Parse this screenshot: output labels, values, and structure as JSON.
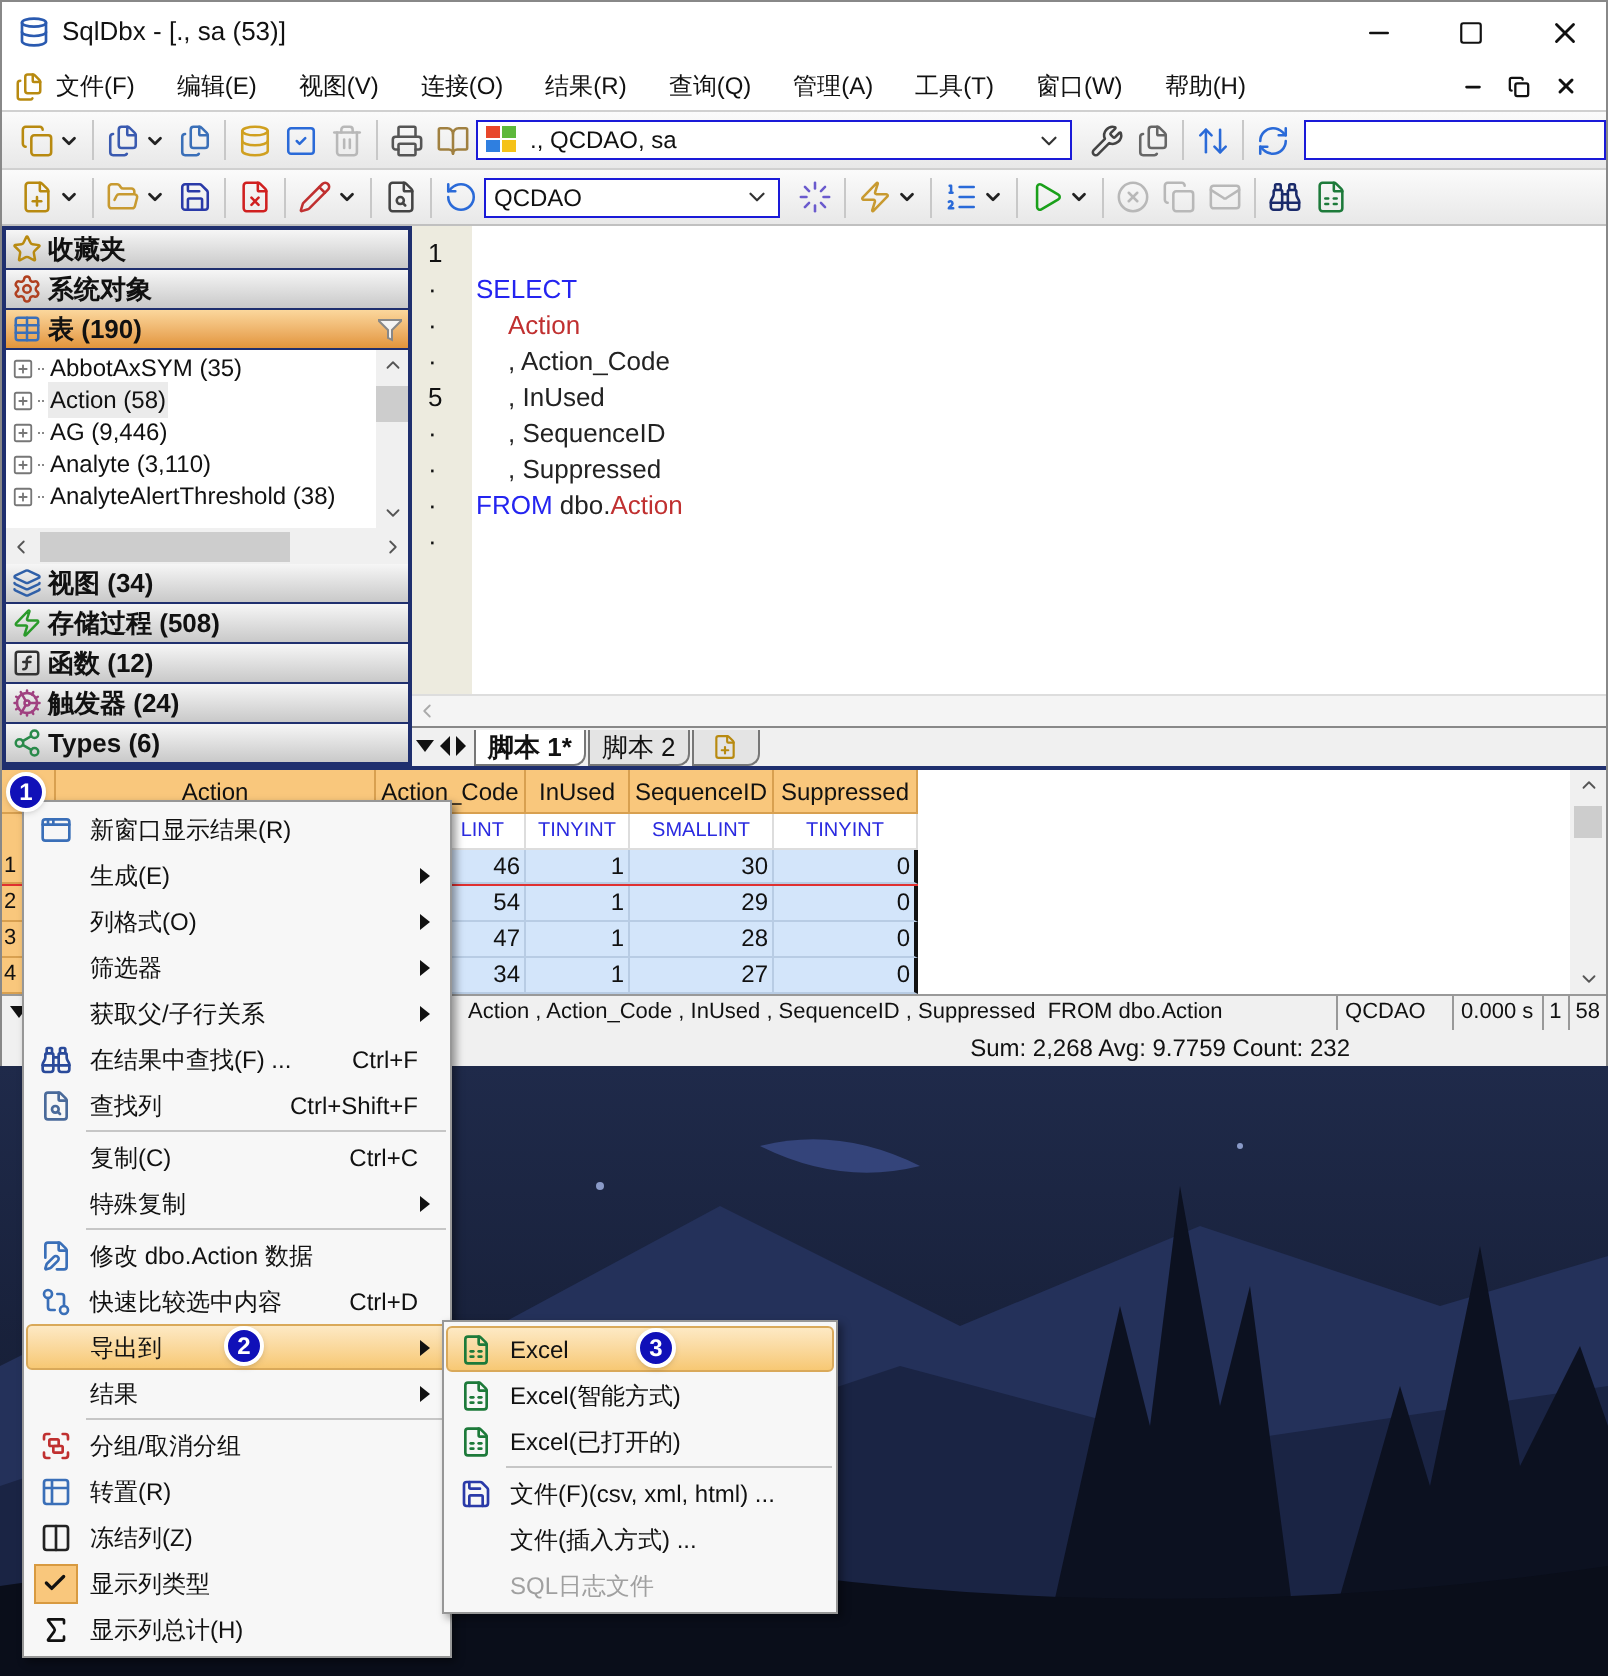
{
  "window": {
    "title": "SqlDbx - [., sa (53)]"
  },
  "menu_bar": [
    "文件(F)",
    "编辑(E)",
    "视图(V)",
    "连接(O)",
    "结果(R)",
    "查询(Q)",
    "管理(A)",
    "工具(T)",
    "窗口(W)",
    "帮助(H)"
  ],
  "toolbar": {
    "connection": "., QCDAO, sa",
    "database": "QCDAO"
  },
  "sidebar": {
    "sections": [
      {
        "label": "收藏夹",
        "selected": false
      },
      {
        "label": "系统对象",
        "selected": false
      },
      {
        "label": "表 (190)",
        "selected": true,
        "items": [
          {
            "label": "AbbotAxSYM  (35)",
            "selected": false
          },
          {
            "label": "Action  (58)",
            "selected": true
          },
          {
            "label": "AG  (9,446)",
            "selected": false
          },
          {
            "label": "Analyte  (3,110)",
            "selected": false
          },
          {
            "label": "AnalyteAlertThreshold  (38)",
            "selected": false
          }
        ]
      },
      {
        "label": "视图 (34)",
        "selected": false
      },
      {
        "label": "存储过程 (508)",
        "selected": false
      },
      {
        "label": "函数 (12)",
        "selected": false
      },
      {
        "label": "触发器 (24)",
        "selected": false
      },
      {
        "label": "Types (6)",
        "selected": false
      }
    ]
  },
  "editor": {
    "lines": [
      {
        "number": "1"
      },
      {
        "number": "·",
        "tokens": [
          {
            "text": "SELECT",
            "kind": "keyword"
          }
        ]
      },
      {
        "number": "·",
        "indent": true,
        "tokens": [
          {
            "text": "Action",
            "kind": "identifier"
          }
        ]
      },
      {
        "number": "·",
        "indent": true,
        "tokens": [
          {
            "text": ", Action_Code",
            "kind": "plain"
          }
        ]
      },
      {
        "number": "5",
        "indent": true,
        "tokens": [
          {
            "text": ", InUsed",
            "kind": "plain"
          }
        ]
      },
      {
        "number": "·",
        "indent": true,
        "tokens": [
          {
            "text": ", SequenceID",
            "kind": "plain"
          }
        ]
      },
      {
        "number": "·",
        "indent": true,
        "tokens": [
          {
            "text": ", Suppressed",
            "kind": "plain"
          }
        ]
      },
      {
        "number": "·",
        "tokens": [
          {
            "text": "FROM",
            "kind": "keyword"
          },
          {
            "text": " dbo.",
            "kind": "plain"
          },
          {
            "text": "Action",
            "kind": "identifier"
          }
        ]
      },
      {
        "number": "·"
      }
    ],
    "tabs": [
      {
        "label": "脚本 1*",
        "selected": true
      },
      {
        "label": "脚本 2",
        "selected": false
      }
    ]
  },
  "grid": {
    "columns": [
      {
        "name": "Action"
      },
      {
        "name": "Action_Code",
        "type": "LINT"
      },
      {
        "name": "InUsed",
        "type": "TINYINT"
      },
      {
        "name": "SequenceID",
        "type": "SMALLINT"
      },
      {
        "name": "Suppressed",
        "type": "TINYINT"
      }
    ],
    "rows": [
      {
        "number": "1",
        "current": true,
        "values": [
          "46",
          "1",
          "30",
          "0"
        ]
      },
      {
        "number": "2",
        "current": false,
        "values": [
          "54",
          "1",
          "29",
          "0"
        ]
      },
      {
        "number": "3",
        "current": false,
        "values": [
          "47",
          "1",
          "28",
          "0"
        ]
      },
      {
        "number": "4",
        "current": false,
        "values": [
          "34",
          "1",
          "27",
          "0"
        ]
      }
    ]
  },
  "status_bar": {
    "query": "Action , Action_Code , InUsed , SequenceID , Suppressed  FROM dbo.Action",
    "database": "QCDAO",
    "time": "0.000 s",
    "line": "1",
    "column": "58",
    "totals": "Sum: 2,268 Avg: 9.7759 Count: 232"
  },
  "context_menu": {
    "badge": "1",
    "items": [
      {
        "kind": "item",
        "label": "新窗口显示结果(R)",
        "selected": false,
        "checked": false
      },
      {
        "kind": "item",
        "label": "生成(E)",
        "submenu": true,
        "selected": false,
        "checked": false
      },
      {
        "kind": "item",
        "label": "列格式(O)",
        "submenu": true,
        "selected": false,
        "checked": false
      },
      {
        "kind": "item",
        "label": "筛选器",
        "submenu": true,
        "selected": false,
        "checked": false
      },
      {
        "kind": "item",
        "label": "获取父/子行关系",
        "submenu": true,
        "selected": false,
        "checked": false
      },
      {
        "kind": "item",
        "label": "在结果中查找(F) ...",
        "shortcut": "Ctrl+F",
        "selected": false,
        "checked": false
      },
      {
        "kind": "item",
        "label": "查找列",
        "shortcut": "Ctrl+Shift+F",
        "selected": false,
        "checked": false
      },
      {
        "kind": "separator"
      },
      {
        "kind": "item",
        "label": "复制(C)",
        "shortcut": "Ctrl+C",
        "selected": false,
        "checked": false
      },
      {
        "kind": "item",
        "label": "特殊复制",
        "submenu": true,
        "selected": false,
        "checked": false
      },
      {
        "kind": "separator"
      },
      {
        "kind": "item",
        "label": "修改 dbo.Action 数据",
        "selected": false,
        "checked": false
      },
      {
        "kind": "item",
        "label": "快速比较选中内容",
        "shortcut": "Ctrl+D",
        "selected": false,
        "checked": false
      },
      {
        "kind": "item",
        "label": "导出到",
        "submenu": true,
        "selected": true,
        "checked": false,
        "badge": "2"
      },
      {
        "kind": "item",
        "label": "结果",
        "submenu": true,
        "selected": false,
        "checked": false
      },
      {
        "kind": "separator"
      },
      {
        "kind": "item",
        "label": "分组/取消分组",
        "selected": false,
        "checked": false
      },
      {
        "kind": "item",
        "label": "转置(R)",
        "selected": false,
        "checked": false
      },
      {
        "kind": "item",
        "label": "冻结列(Z)",
        "selected": false,
        "checked": false
      },
      {
        "kind": "item",
        "label": "显示列类型",
        "selected": false,
        "checked": true
      },
      {
        "kind": "item",
        "label": "显示列总计(H)",
        "selected": false,
        "checked": false
      }
    ]
  },
  "submenu": {
    "items": [
      {
        "kind": "item",
        "label": "Excel",
        "selected": true,
        "disabled": false,
        "badge": "3"
      },
      {
        "kind": "item",
        "label": "Excel(智能方式)",
        "selected": false,
        "disabled": false
      },
      {
        "kind": "item",
        "label": "Excel(已打开的)",
        "selected": false,
        "disabled": false
      },
      {
        "kind": "separator"
      },
      {
        "kind": "item",
        "label": "文件(F)(csv, xml, html) ...",
        "selected": false,
        "disabled": false
      },
      {
        "kind": "item",
        "label": "文件(插入方式) ...",
        "selected": false,
        "disabled": false
      },
      {
        "kind": "item",
        "label": "SQL日志文件",
        "selected": false,
        "disabled": true
      }
    ]
  }
}
